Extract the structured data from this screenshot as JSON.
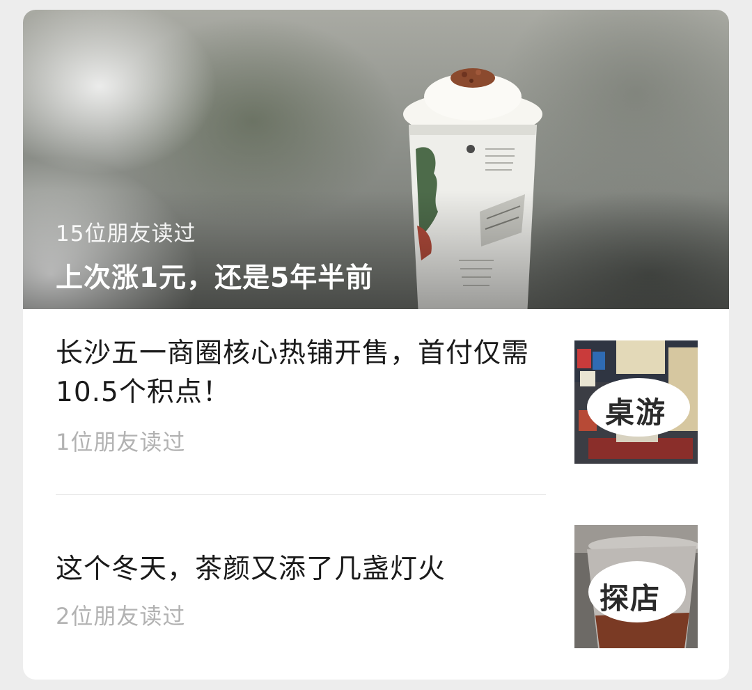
{
  "hero": {
    "readers": "15位朋友读过",
    "title": "上次涨1元，还是5年半前"
  },
  "articles": [
    {
      "title": "长沙五一商圈核心热铺开售，首付仅需10.5个积点！",
      "readers": "1位朋友读过",
      "thumb_tag": "桌游"
    },
    {
      "title": "这个冬天，茶颜又添了几盏灯火",
      "readers": "2位朋友读过",
      "thumb_tag": "探店"
    }
  ]
}
